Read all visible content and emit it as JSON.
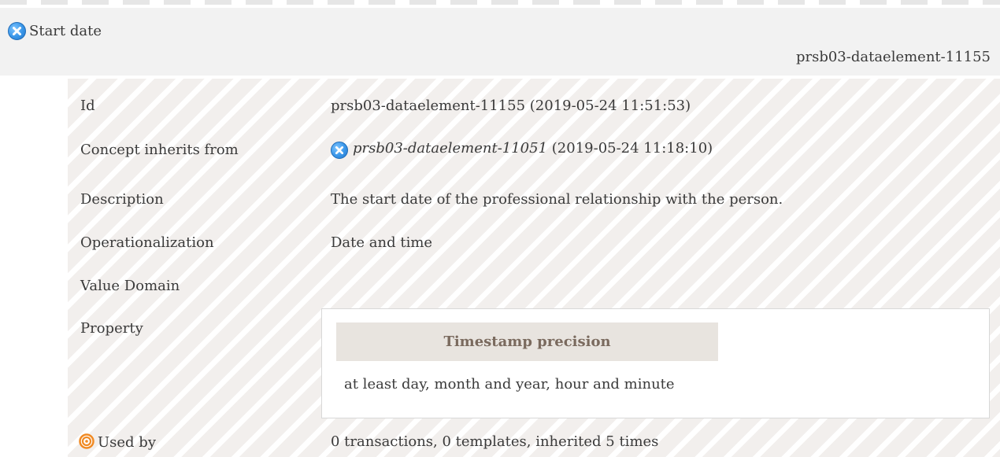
{
  "header": {
    "title": "Start date",
    "id": "prsb03-dataelement-11155",
    "status_icon": "x-circle-icon",
    "status_color": "#3a96e8"
  },
  "rows": {
    "id": {
      "label": "Id",
      "value": "prsb03-dataelement-11155 (2019-05-24 11:51:53)"
    },
    "inherits": {
      "label": "Concept inherits from",
      "ref": "prsb03-dataelement-11051",
      "date": "(2019-05-24 11:18:10)"
    },
    "description": {
      "label": "Description",
      "value": "The start date of the professional relationship with the person."
    },
    "operationalization": {
      "label": "Operationalization",
      "value": "Date and time"
    },
    "value_domain": {
      "label": "Value Domain",
      "value": ""
    },
    "property": {
      "label": "Property",
      "heading": "Timestamp precision",
      "value": "at least day, month and year, hour and minute"
    },
    "used_by": {
      "label": "Used by",
      "value": "0 transactions, 0 templates, inherited 5 times",
      "icon": "target-icon",
      "icon_color": "#f08a24"
    }
  }
}
